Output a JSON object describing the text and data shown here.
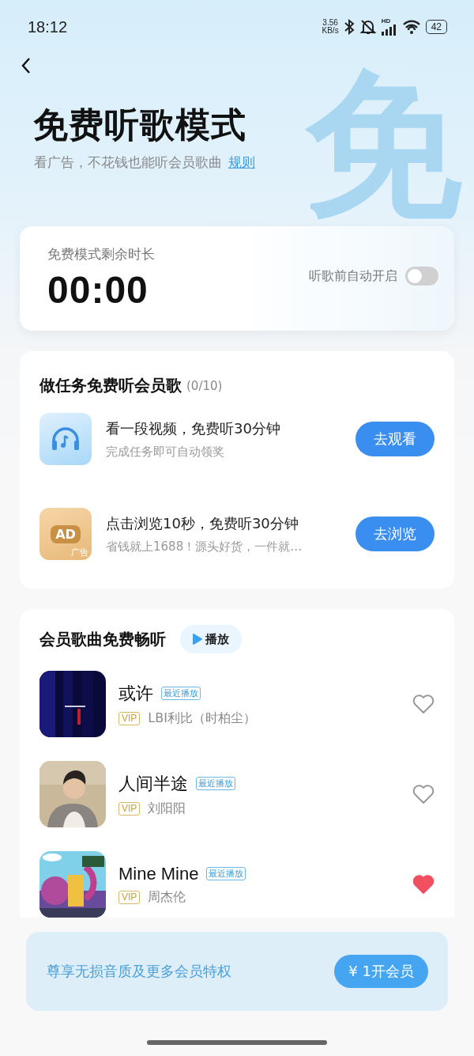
{
  "status_bar": {
    "time": "18:12",
    "net_speed": "3.56",
    "net_unit": "KB/s",
    "signal_label": "HD",
    "battery": "42"
  },
  "header": {
    "title": "免费听歌模式",
    "subtitle": "看广告，不花钱也能听会员歌曲",
    "rules_link": "规则",
    "hero_glyph": "免"
  },
  "timer_card": {
    "label": "免费模式剩余时长",
    "time": "00:00",
    "auto_label": "听歌前自动开启",
    "auto_on": false
  },
  "tasks": {
    "title": "做任务免费听会员歌",
    "progress": "(0/10)",
    "items": [
      {
        "kind": "headphones",
        "title": "看一段视频，免费听30分钟",
        "subtitle": "完成任务即可自动领奖",
        "button": "去观看"
      },
      {
        "kind": "ad",
        "icon_text": "AD",
        "icon_label": "广告",
        "title": "点击浏览10秒，免费听30分钟",
        "subtitle": "省钱就上1688！源头好货，一件就…",
        "button": "去浏览"
      }
    ]
  },
  "songs": {
    "title": "会员歌曲免费畅听",
    "play_button": "播放",
    "items": [
      {
        "title": "或许",
        "tag": "最近播放",
        "badge": "VIP",
        "artist": "LBI利比（时柏尘）",
        "liked": false
      },
      {
        "title": "人间半途",
        "tag": "最近播放",
        "badge": "VIP",
        "artist": "刘阳阳",
        "liked": false
      },
      {
        "title": "Mine Mine",
        "tag": "最近播放",
        "badge": "VIP",
        "artist": "周杰伦",
        "liked": true
      }
    ]
  },
  "vip_banner": {
    "text": "尊享无损音质及更多会员特权",
    "button": "¥ 1开会员"
  }
}
